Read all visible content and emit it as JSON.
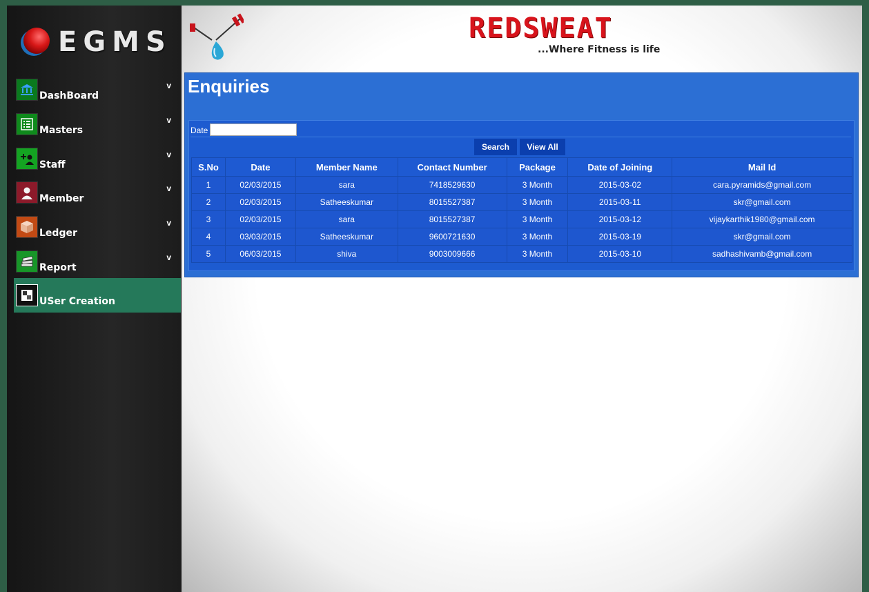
{
  "app": {
    "logo_text": "EGMS"
  },
  "sidebar": {
    "items": [
      {
        "label": "DashBoard",
        "icon": "bank-icon",
        "has_chevron": true
      },
      {
        "label": "Masters",
        "icon": "list-icon",
        "has_chevron": true
      },
      {
        "label": "Staff",
        "icon": "add-user-icon",
        "has_chevron": true
      },
      {
        "label": "Member",
        "icon": "person-icon",
        "has_chevron": true
      },
      {
        "label": "Ledger",
        "icon": "box-icon",
        "has_chevron": true
      },
      {
        "label": "Report",
        "icon": "books-icon",
        "has_chevron": true
      },
      {
        "label": "USer Creation",
        "icon": "user-card-icon",
        "has_chevron": false,
        "active": true
      }
    ],
    "chevron": "v"
  },
  "header": {
    "brand_name": "REDSWEAT",
    "tagline": "...Where Fitness is life"
  },
  "main": {
    "title": "Enquiries",
    "filter": {
      "date_label": "Date",
      "date_value": ""
    },
    "buttons": {
      "search": "Search",
      "view_all": "View All"
    },
    "table": {
      "columns": [
        "S.No",
        "Date",
        "Member Name",
        "Contact Number",
        "Package",
        "Date of Joining",
        "Mail Id"
      ],
      "rows": [
        [
          "1",
          "02/03/2015",
          "sara",
          "7418529630",
          "3 Month",
          "2015-03-02",
          "cara.pyramids@gmail.com"
        ],
        [
          "2",
          "02/03/2015",
          "Satheeskumar",
          "8015527387",
          "3 Month",
          "2015-03-11",
          "skr@gmail.com"
        ],
        [
          "3",
          "02/03/2015",
          "sara",
          "8015527387",
          "3 Month",
          "2015-03-12",
          "vijaykarthik1980@gmail.com"
        ],
        [
          "4",
          "03/03/2015",
          "Satheeskumar",
          "9600721630",
          "3 Month",
          "2015-03-19",
          "skr@gmail.com"
        ],
        [
          "5",
          "06/03/2015",
          "shiva",
          "9003009666",
          "3 Month",
          "2015-03-10",
          "sadhashivamb@gmail.com"
        ]
      ]
    }
  },
  "colors": {
    "sidebar_active": "#25795a",
    "panel_blue": "#2c6fd4",
    "brand_red": "#d8141c",
    "button_blue": "#0b3fae"
  }
}
